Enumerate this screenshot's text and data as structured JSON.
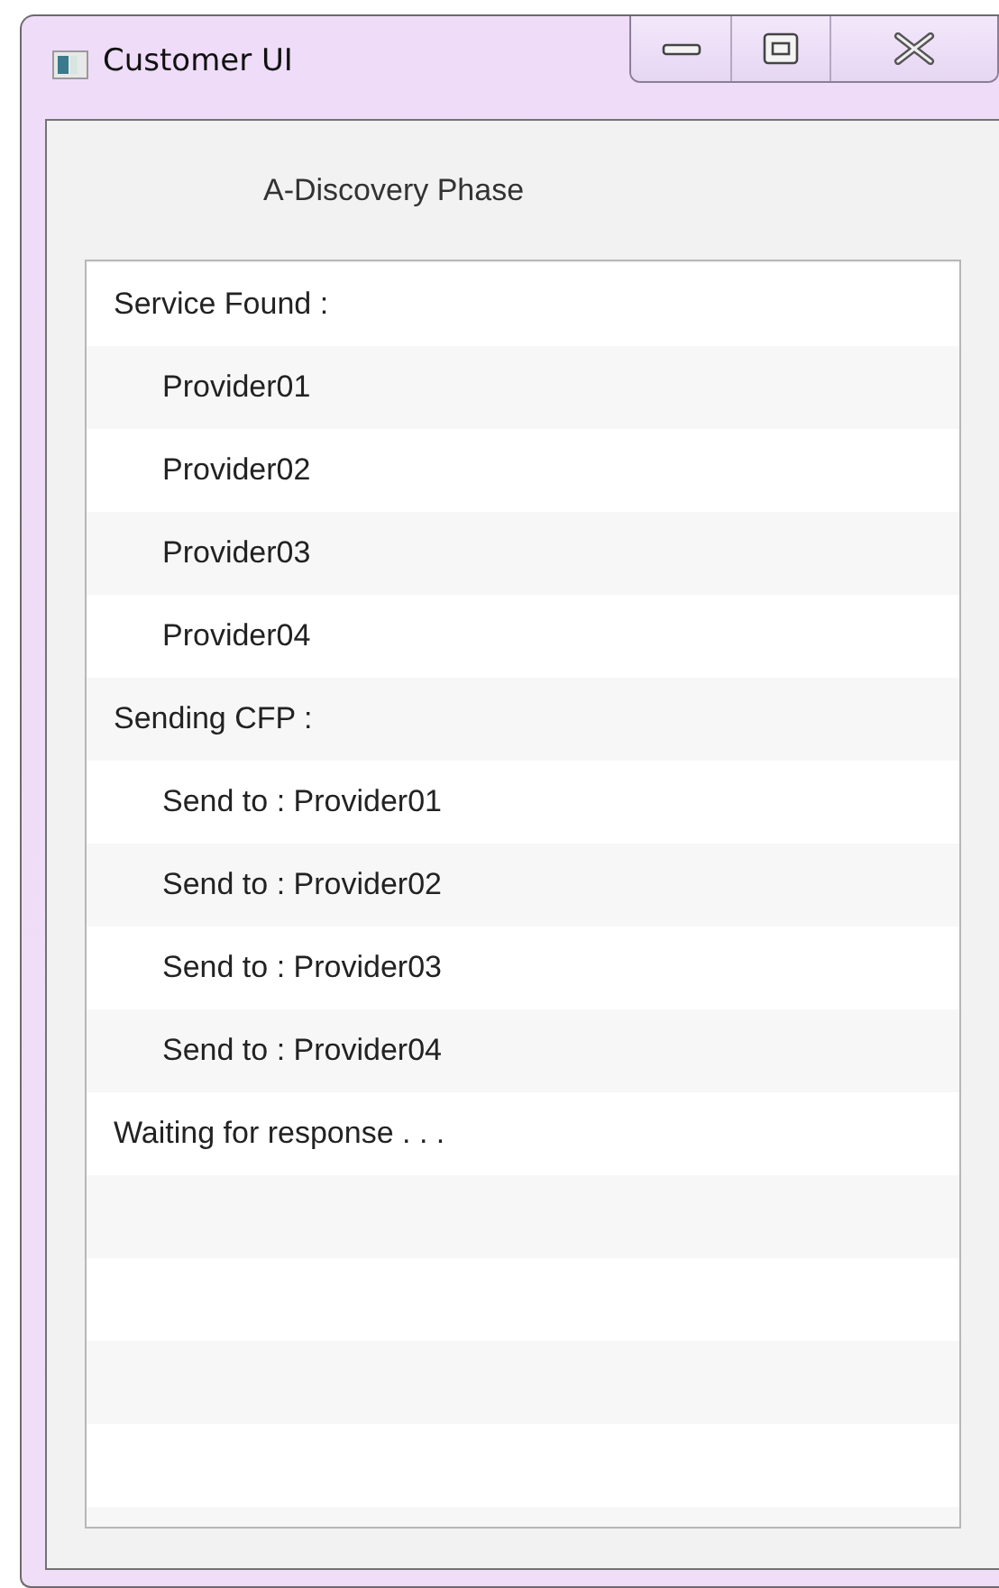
{
  "window": {
    "title": "Customer UI"
  },
  "heading": "A-Discovery Phase",
  "log": [
    {
      "text": "Service Found :",
      "children": [
        {
          "text": "Provider01"
        },
        {
          "text": "Provider02"
        },
        {
          "text": "Provider03"
        },
        {
          "text": "Provider04"
        }
      ]
    },
    {
      "text": "Sending CFP :",
      "children": [
        {
          "text": "Send to : Provider01"
        },
        {
          "text": "Send to : Provider02"
        },
        {
          "text": "Send to : Provider03"
        },
        {
          "text": "Send to : Provider04"
        }
      ]
    },
    {
      "text": "Waiting for response  . . ."
    }
  ]
}
